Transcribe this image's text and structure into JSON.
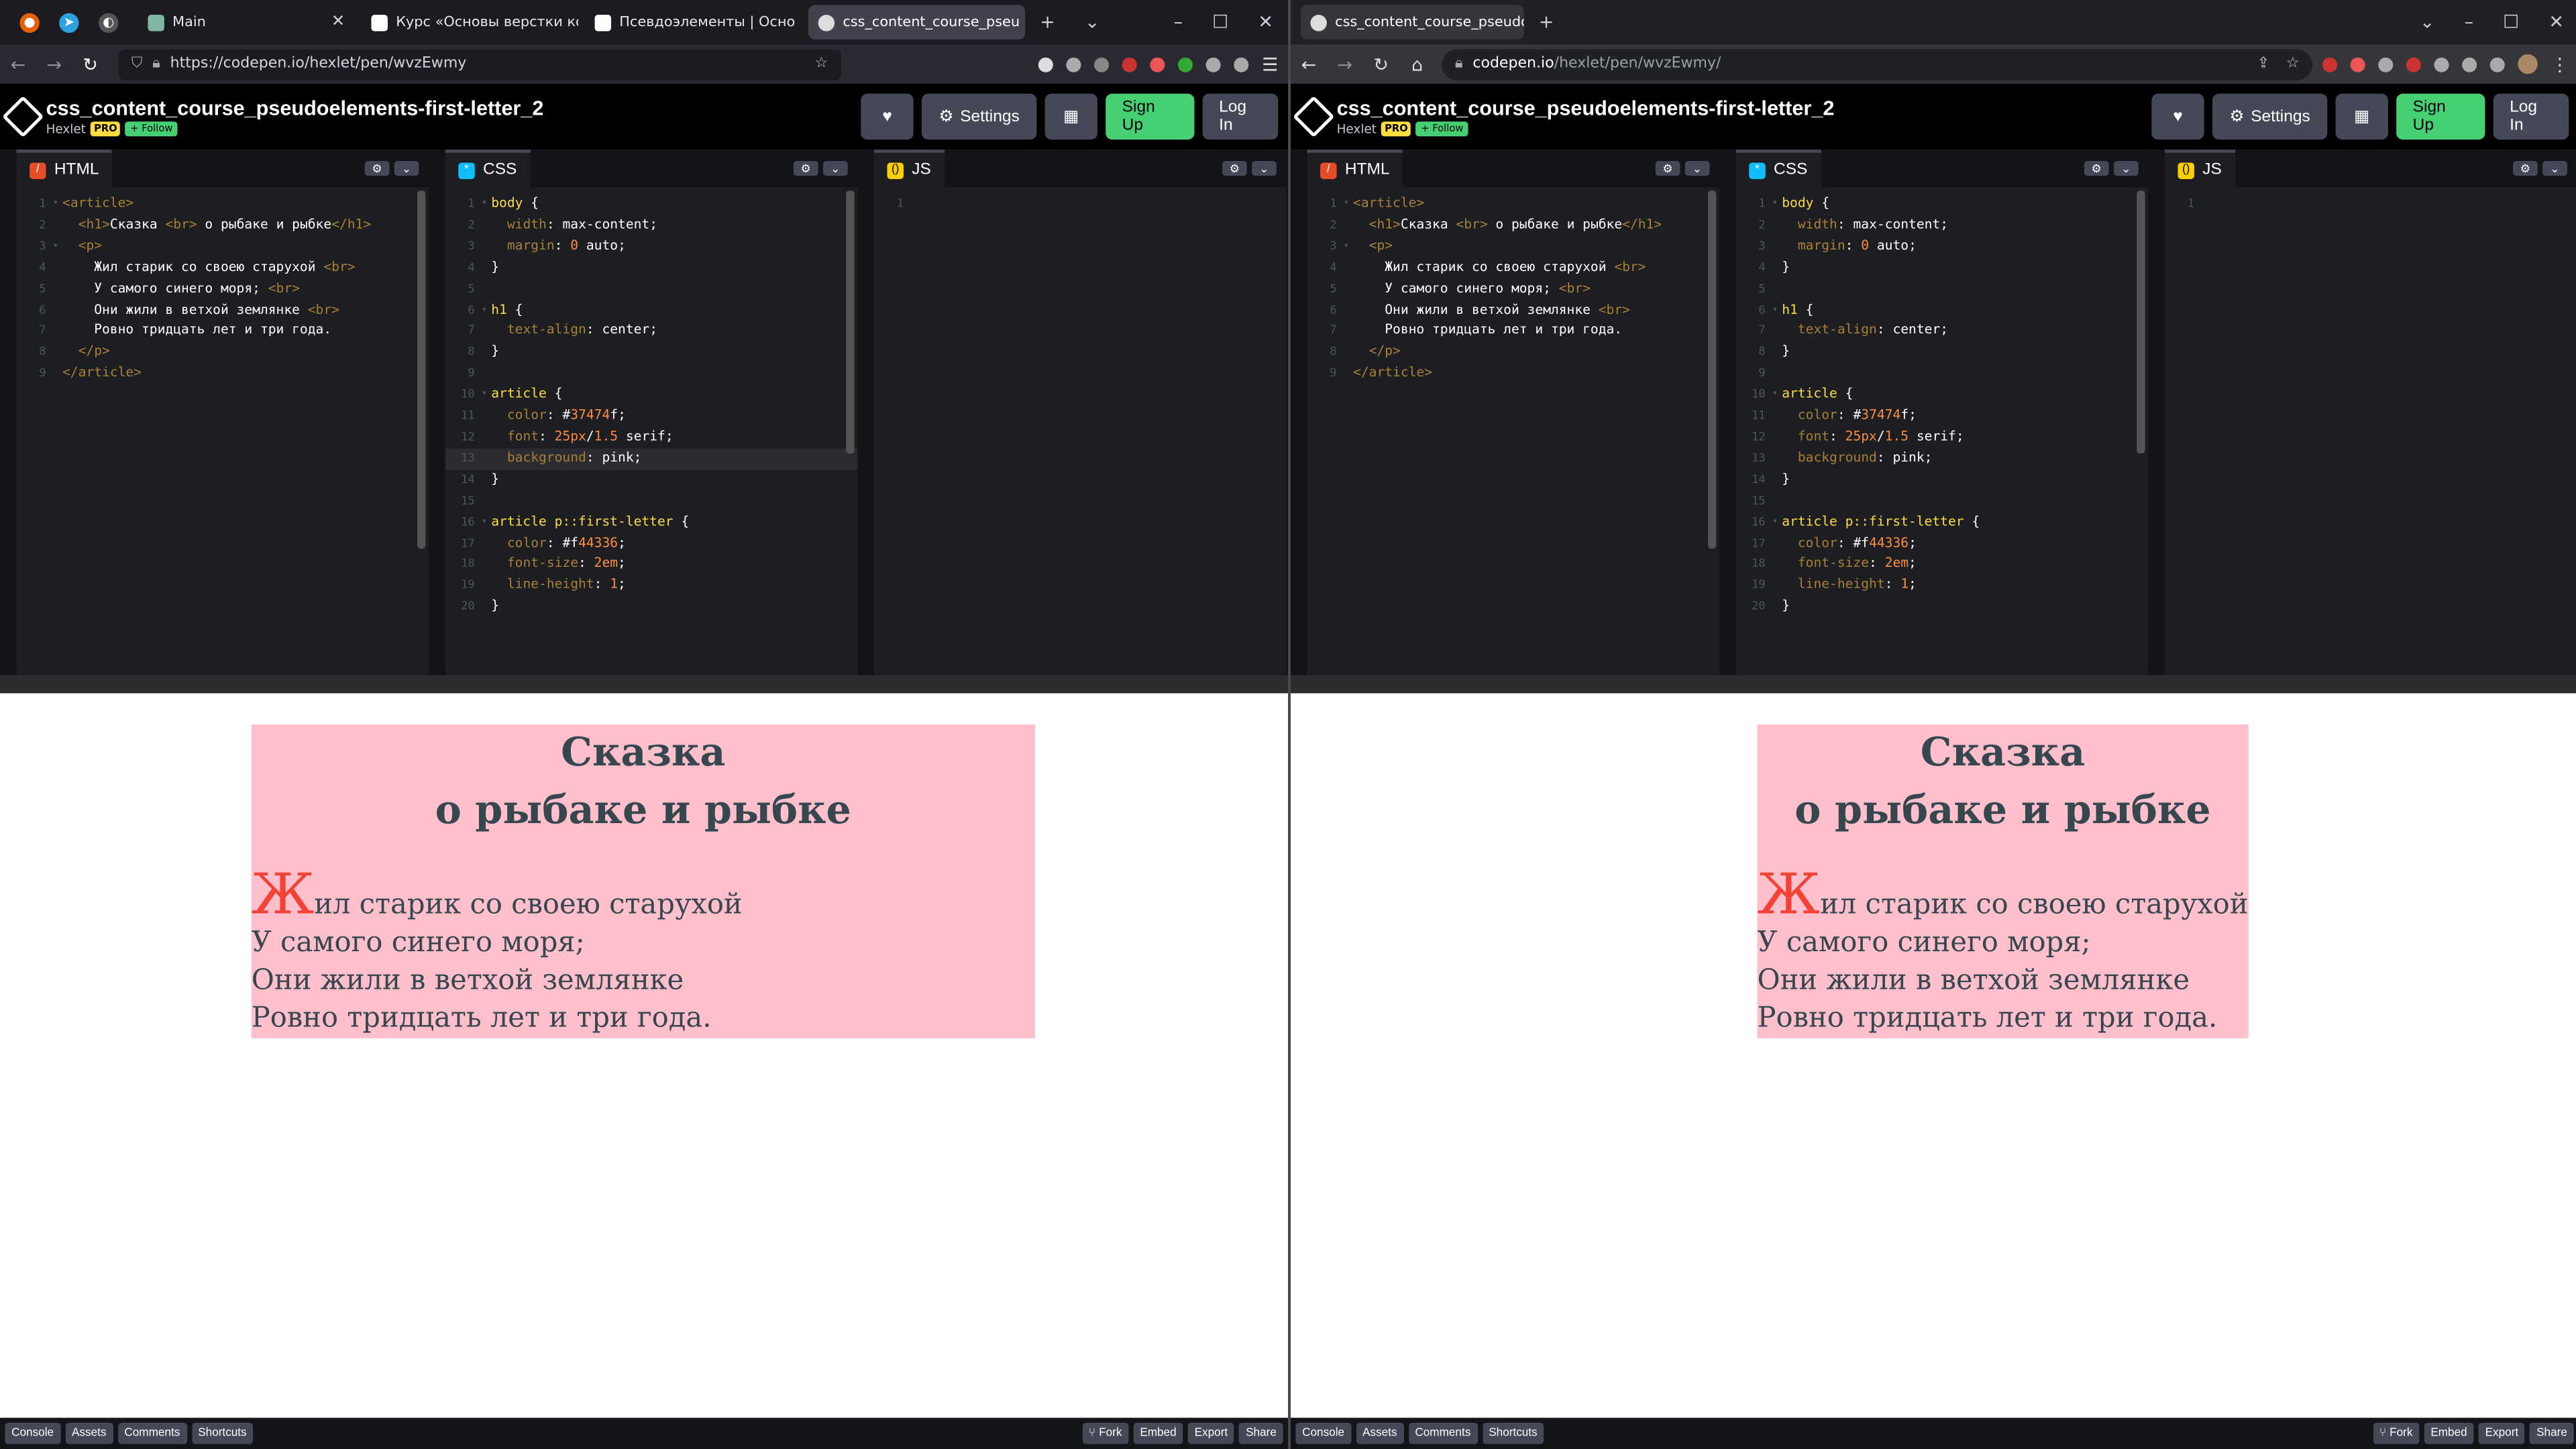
{
  "left_browser": {
    "tabs": [
      {
        "label": "Main"
      },
      {
        "label": "Курс «Основы верстки ко"
      },
      {
        "label": "Псевдоэлементы | Осно"
      },
      {
        "label": "css_content_course_pseu"
      }
    ],
    "url": "https://codepen.io/hexlet/pen/wvzEwmy"
  },
  "right_browser": {
    "tabs": [
      {
        "label": "css_content_course_pseudo"
      }
    ],
    "url_host": "codepen.io",
    "url_path": "/hexlet/pen/wvzEwmy/"
  },
  "codepen": {
    "title": "css_content_course_pseudoelements-first-letter_2",
    "owner": "Hexlet",
    "pro_badge": "PRO",
    "follow_label": "+ Follow",
    "settings_label": "Settings",
    "signup_label": "Sign Up",
    "login_label": "Log In",
    "html_tab": "HTML",
    "css_tab": "CSS",
    "js_tab": "JS",
    "html_code": [
      "<article>",
      "  <h1>Сказка <br> о рыбаке и рыбке</h1>",
      "  <p>",
      "    Жил старик со своею старухой <br>",
      "    У самого синего моря; <br>",
      "    Они жили в ветхой землянке <br>",
      "    Ровно тридцать лет и три года.",
      "  </p>",
      "</article>"
    ],
    "css_code": [
      "body {",
      "  width: max-content;",
      "  margin: 0 auto;",
      "}",
      "",
      "h1 {",
      "  text-align: center;",
      "}",
      "",
      "article {",
      "  color: #37474f;",
      "  font: 25px/1.5 serif;",
      "  background: pink;",
      "}",
      "",
      "article p::first-letter {",
      "  color: #f44336;",
      "  font-size: 2em;",
      "  line-height: 1;",
      "}"
    ],
    "js_line_number": "1",
    "footer_left": [
      "Console",
      "Assets",
      "Comments",
      "Shortcuts"
    ],
    "footer_right": [
      "Fork",
      "Embed",
      "Export",
      "Share"
    ]
  },
  "preview": {
    "heading_line1": "Сказка",
    "heading_line2": "о рыбаке и рыбке",
    "first_letter": "Ж",
    "line1_rest": "ил старик со своею старухой",
    "line2": "У самого синего моря;",
    "line3": "Они жили в ветхой землянке",
    "line4": "Ровно тридцать лет и три года."
  },
  "colors": {
    "article_bg": "pink",
    "text": "#37474f",
    "first_letter": "#f44336",
    "codepen_green": "#47cf73"
  }
}
